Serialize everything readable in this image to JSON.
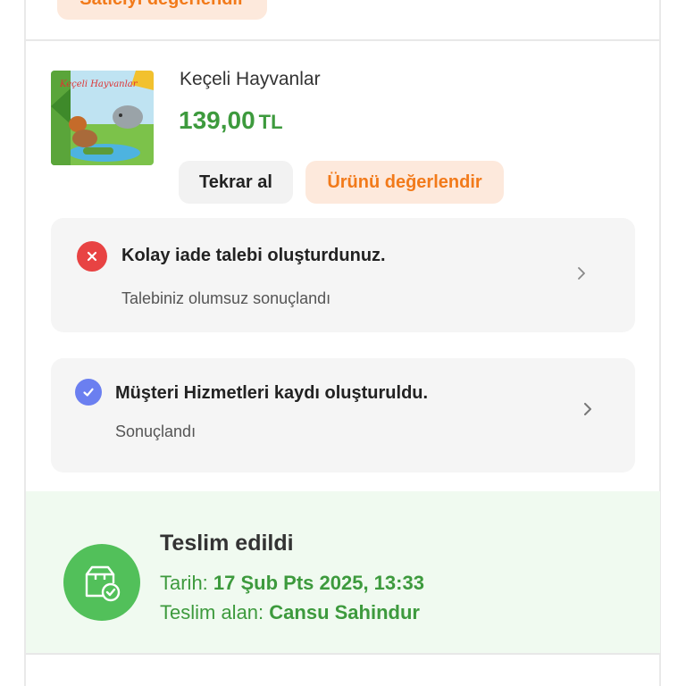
{
  "seller": {
    "rate_label": "Satıcıyı değerlendir"
  },
  "product": {
    "name": "Keçeli Hayvanlar",
    "price": "139,00",
    "currency": "TL",
    "image_title": "Keçeli Hayvanlar",
    "buttons": {
      "rebuy": "Tekrar al",
      "rate": "Ürünü değerlendir"
    }
  },
  "requests": [
    {
      "status": "rejected",
      "title": "Kolay iade talebi oluşturdunuz.",
      "subtitle": "Talebiniz olumsuz sonuçlandı",
      "icon": "x-icon",
      "color": "#e84343"
    },
    {
      "status": "completed",
      "title": "Müşteri Hizmetleri kaydı oluşturuldu.",
      "subtitle": "Sonuçlandı",
      "icon": "check-icon",
      "color": "#6b7ff0"
    }
  ],
  "delivery": {
    "title": "Teslim edildi",
    "date_label": "Tarih:",
    "date_value": "17 Şub Pts 2025, 13:33",
    "receiver_label": "Teslim alan:",
    "receiver_value": "Cansu Sahindur",
    "icon": "package-check-icon"
  },
  "colors": {
    "accent_orange": "#f27a1a",
    "accent_green": "#3d9a3d",
    "delivery_icon_bg": "#52c05a"
  }
}
